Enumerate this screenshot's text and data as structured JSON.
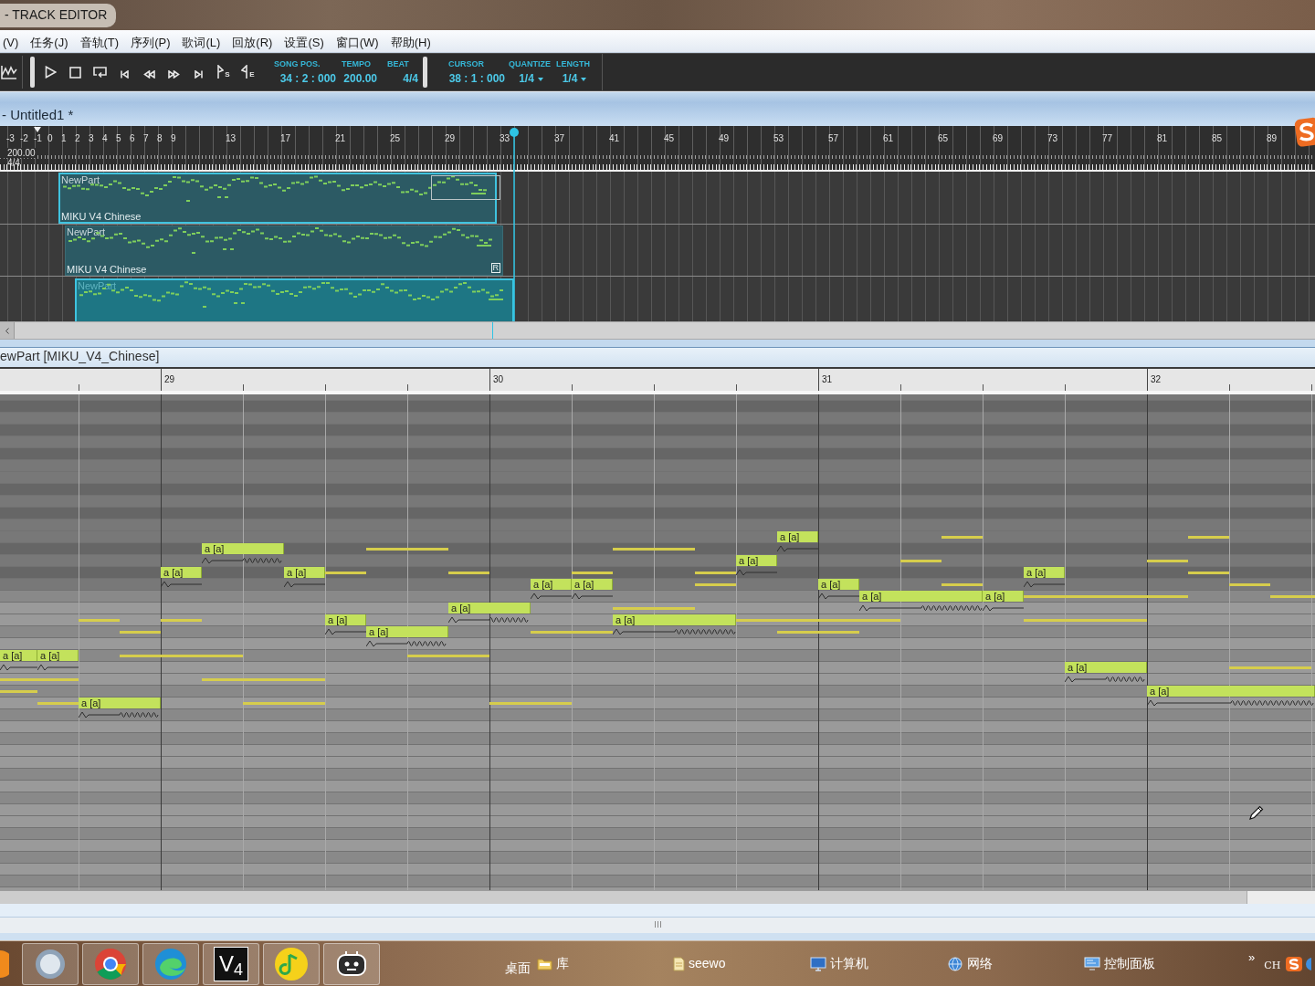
{
  "window": {
    "title": "- TRACK EDITOR"
  },
  "menu": [
    {
      "label": "(V)"
    },
    {
      "label": "任务(J)"
    },
    {
      "label": "音轨(T)"
    },
    {
      "label": "序列(P)"
    },
    {
      "label": "歌词(L)"
    },
    {
      "label": "回放(R)"
    },
    {
      "label": "设置(S)"
    },
    {
      "label": "窗口(W)"
    },
    {
      "label": "帮助(H)"
    }
  ],
  "toolbar": {
    "tools": [
      {
        "kind": "waveform"
      }
    ],
    "transport": [
      {
        "kind": "play"
      },
      {
        "kind": "stop"
      },
      {
        "kind": "loop"
      },
      {
        "kind": "skip-back"
      },
      {
        "kind": "rewind"
      },
      {
        "kind": "forward"
      },
      {
        "kind": "skip-forward"
      },
      {
        "kind": "start-marker",
        "sub": "S"
      },
      {
        "kind": "end-marker",
        "sub": "E"
      }
    ],
    "position": [
      {
        "kind": "readout",
        "label": "SONG POS.",
        "value": "34 : 2 : 000"
      },
      {
        "kind": "readout",
        "label": "TEMPO",
        "value": "200.00"
      },
      {
        "kind": "readout",
        "label": "BEAT",
        "value": "4/4"
      }
    ],
    "cursor": [
      {
        "kind": "readout",
        "label": "CURSOR",
        "value": "38 : 1 : 000"
      },
      {
        "kind": "dropdown",
        "label": "QUANTIZE",
        "value": "1/4"
      },
      {
        "kind": "dropdown",
        "label": "LENGTH",
        "value": "1/4"
      }
    ]
  },
  "document": {
    "title": "- Untitled1 *"
  },
  "ruler": {
    "bars": [
      "-3",
      "-2",
      "-1",
      "0",
      "1",
      "2",
      "3",
      "4",
      "5",
      "6",
      "7",
      "8",
      "9",
      "13",
      "17",
      "21",
      "25",
      "29",
      "33",
      "37",
      "41",
      "45",
      "49",
      "53",
      "57",
      "61",
      "65",
      "69",
      "73",
      "77",
      "81",
      "85",
      "89"
    ],
    "tempo": "200.00",
    "time_signature": "4/4"
  },
  "tracks": [
    {
      "part": {
        "name": "NewPart",
        "singer": "MIKU V4 Chinese",
        "selected": true,
        "current": false
      }
    },
    {
      "part": {
        "name": "NewPart",
        "singer": "MIKU V4 Chinese",
        "badge": "R",
        "selected": false,
        "current": false
      }
    },
    {
      "part": {
        "name": "NewPart",
        "selected": true,
        "current": true
      }
    }
  ],
  "editor": {
    "title": "ewPart [MIKU_V4_Chinese]",
    "measures": [
      "29",
      "30",
      "31",
      "32"
    ],
    "notes": [
      {
        "lyric": "a [a]",
        "vibrato": false
      },
      {
        "lyric": "a [a]",
        "vibrato": false
      },
      {
        "lyric": "a [a]",
        "vibrato": true
      },
      {
        "lyric": "a [a]",
        "vibrato": false
      },
      {
        "lyric": "a [a]",
        "vibrato": true
      },
      {
        "lyric": "a [a]",
        "vibrato": false
      },
      {
        "lyric": "a [a]",
        "vibrato": false
      },
      {
        "lyric": "a [a]",
        "vibrato": true
      },
      {
        "lyric": "a [a]",
        "vibrato": true
      },
      {
        "lyric": "a [a]",
        "vibrato": false
      },
      {
        "lyric": "a [a]",
        "vibrato": false
      },
      {
        "lyric": "a [a]",
        "vibrato": true
      },
      {
        "lyric": "a [a]",
        "vibrato": false
      },
      {
        "lyric": "a [a]",
        "vibrato": false
      },
      {
        "lyric": "a [a]",
        "vibrato": false
      },
      {
        "lyric": "a [a]",
        "vibrato": true
      },
      {
        "lyric": "a [a]",
        "vibrato": false
      },
      {
        "lyric": "a [a]",
        "vibrato": false
      },
      {
        "lyric": "a [a]",
        "vibrato": true
      },
      {
        "lyric": "a [a]",
        "vibrato": true
      }
    ]
  },
  "taskbar": {
    "apps": [
      {
        "kind": "orb"
      },
      {
        "kind": "disc"
      },
      {
        "kind": "ring"
      },
      {
        "kind": "swirl"
      },
      {
        "kind": "tile",
        "label": "V$_{4}$"
      },
      {
        "kind": "note"
      },
      {
        "kind": "robot"
      }
    ],
    "links": [
      {
        "kind": "plain",
        "label": "桌面"
      },
      {
        "kind": "folder",
        "label": "库"
      },
      {
        "kind": "file",
        "label": "seewo"
      },
      {
        "kind": "computer",
        "label": "计算机"
      },
      {
        "kind": "network",
        "label": "网络"
      },
      {
        "kind": "panel",
        "label": "控制面板"
      }
    ],
    "overflow": "»",
    "language": "CH"
  }
}
